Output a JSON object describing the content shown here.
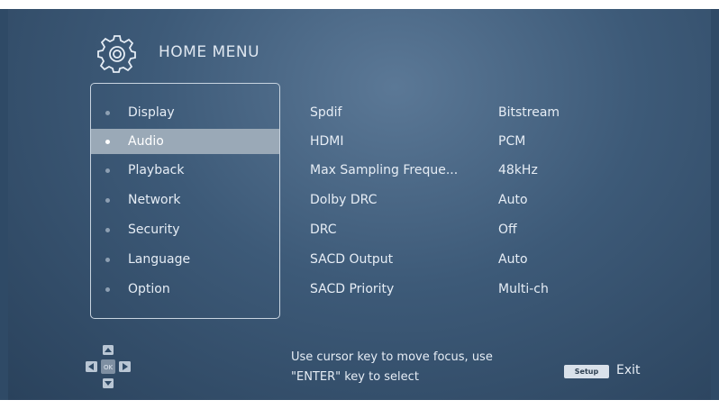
{
  "header": {
    "title": "HOME MENU",
    "icon": "gear-icon"
  },
  "menu": {
    "items": [
      {
        "label": "Display"
      },
      {
        "label": "Audio",
        "selected": true
      },
      {
        "label": "Playback"
      },
      {
        "label": "Network"
      },
      {
        "label": "Security"
      },
      {
        "label": "Language"
      },
      {
        "label": "Option"
      }
    ]
  },
  "settings": [
    {
      "name": "Spdif",
      "value": "Bitstream"
    },
    {
      "name": "HDMI",
      "value": "PCM"
    },
    {
      "name": "Max Sampling Freque...",
      "value": "48kHz"
    },
    {
      "name": "Dolby DRC",
      "value": "Auto"
    },
    {
      "name": "DRC",
      "value": "Off"
    },
    {
      "name": "SACD Output",
      "value": "Auto"
    },
    {
      "name": "SACD Priority",
      "value": "Multi-ch"
    }
  ],
  "footer": {
    "hint_line1": "Use cursor key to move focus, use",
    "hint_line2": "\"ENTER\" key to select",
    "ok_label": "OK",
    "setup_key": "Setup",
    "exit_label": "Exit"
  },
  "colors": {
    "background": "#3d5a78",
    "selected_bg": "#9aa9b7",
    "text": "#e6edf5"
  }
}
